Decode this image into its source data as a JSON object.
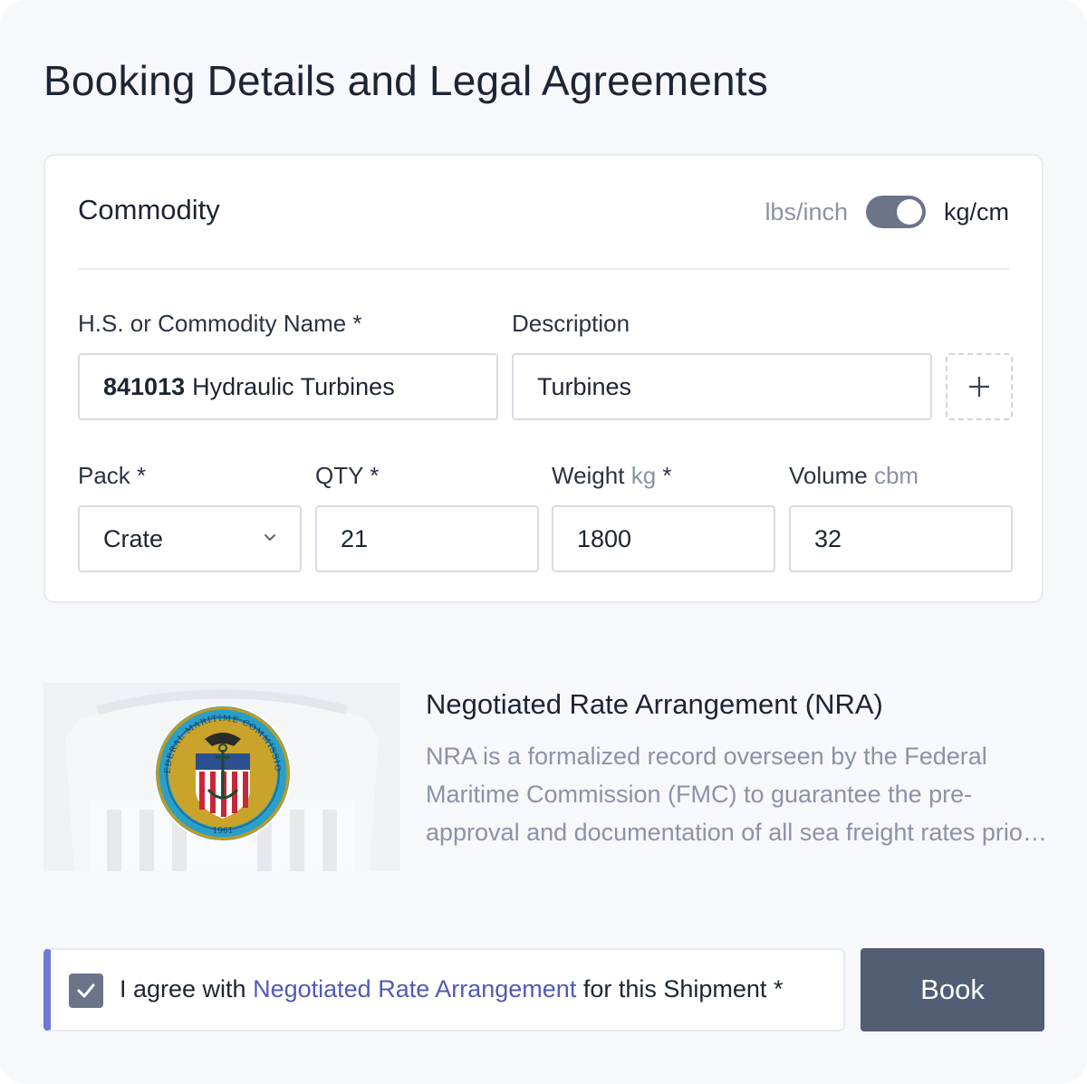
{
  "page": {
    "title": "Booking Details and Legal Agreements"
  },
  "commodity": {
    "title": "Commodity",
    "unit_toggle": {
      "left_label": "lbs/inch",
      "right_label": "kg/cm",
      "selected": "kg/cm"
    },
    "hs_field": {
      "label": "H.S. or Commodity Name *",
      "code": "841013",
      "name": "Hydraulic Turbines"
    },
    "description_field": {
      "label": "Description",
      "value": "Turbines"
    },
    "add_icon": "plus-icon",
    "pack": {
      "label": "Pack *",
      "value": "Crate",
      "icon": "chevron-down-icon"
    },
    "qty": {
      "label": "QTY *",
      "value": "21"
    },
    "weight": {
      "label": "Weight",
      "unit": "kg",
      "required": "*",
      "value": "1800"
    },
    "volume": {
      "label": "Volume",
      "unit": "cbm",
      "value": "32"
    }
  },
  "nra": {
    "seal_text_top": "FEDERAL MARITIME COMMISSION",
    "seal_year": "1961",
    "title": "Negotiated Rate Arrangement (NRA)",
    "description": "NRA is a formalized record overseen by the Federal Maritime Commission (FMC) to guarantee the pre-approval and documentation of all sea freight rates prior to shipment."
  },
  "agreement": {
    "checked": true,
    "prefix": "I agree with",
    "link": "Negotiated Rate Arrangement",
    "suffix": "for this Shipment *"
  },
  "actions": {
    "book_label": "Book"
  },
  "colors": {
    "background": "#f7f8fc",
    "accent": "#6f79d6",
    "link": "#4f5bb5",
    "button": "#515e73",
    "toggle": "#6b7488",
    "muted_text": "#8a93a6"
  }
}
